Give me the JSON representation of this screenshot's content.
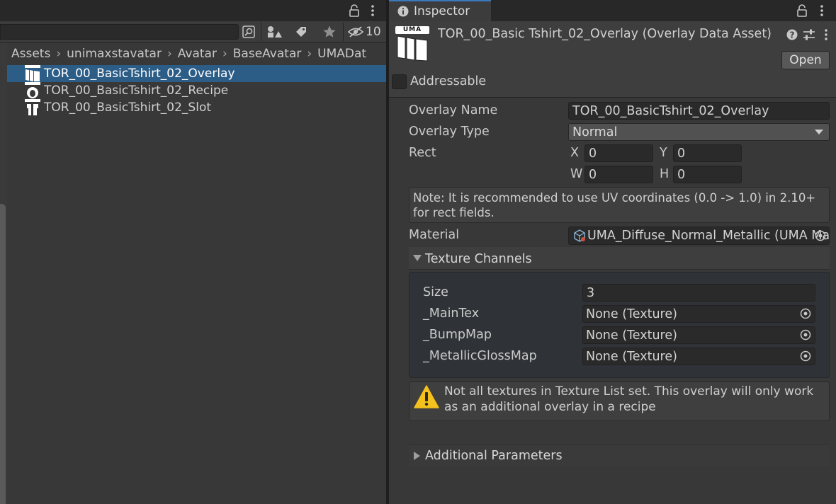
{
  "project": {
    "toolbar": {
      "hidden_count": "10"
    },
    "breadcrumb": [
      "Assets",
      "unimaxstavatar",
      "Avatar",
      "BaseAvatar",
      "UMADat"
    ],
    "files": [
      {
        "name": "TOR_00_BasicTshirt_02_Overlay",
        "icon": "uma-overlay-icon",
        "selected": true
      },
      {
        "name": "TOR_00_BasicTshirt_02_Recipe",
        "icon": "uma-recipe-icon",
        "selected": false
      },
      {
        "name": "TOR_00_BasicTshirt_02_Slot",
        "icon": "uma-slot-icon",
        "selected": false
      }
    ]
  },
  "inspector": {
    "tab_label": "Inspector",
    "asset_title": "TOR_00_Basic Tshirt_02_Overlay (Overlay Data Asset)",
    "logo_text": "UMA",
    "open_label": "Open",
    "addressable_label": "Addressable",
    "overlay_name": {
      "label": "Overlay Name",
      "value": "TOR_00_BasicTshirt_02_Overlay"
    },
    "overlay_type": {
      "label": "Overlay Type",
      "value": "Normal"
    },
    "rect": {
      "label": "Rect",
      "x_label": "X",
      "x": "0",
      "y_label": "Y",
      "y": "0",
      "w_label": "W",
      "w": "0",
      "h_label": "H",
      "h": "0"
    },
    "note": "Note: It is recommended to use UV coordinates (0.0 -> 1.0) in 2.10+ for rect fields.",
    "material": {
      "label": "Material",
      "value": "UMA_Diffuse_Normal_Metallic (UMA Material)"
    },
    "texture_channels": {
      "header": "Texture Channels",
      "size_label": "Size",
      "size": "3",
      "channels": [
        {
          "label": "_MainTex",
          "value": "None (Texture)"
        },
        {
          "label": "_BumpMap",
          "value": "None (Texture)"
        },
        {
          "label": "_MetallicGlossMap",
          "value": "None (Texture)"
        }
      ]
    },
    "warning": "Not all textures in Texture List set. This overlay will only work as an additional overlay in a recipe",
    "additional_parameters": "Additional Parameters"
  },
  "colors": {
    "selection": "#2c5d87",
    "tab_accent": "#3a79bb",
    "warning_yellow": "#f4c21c"
  }
}
